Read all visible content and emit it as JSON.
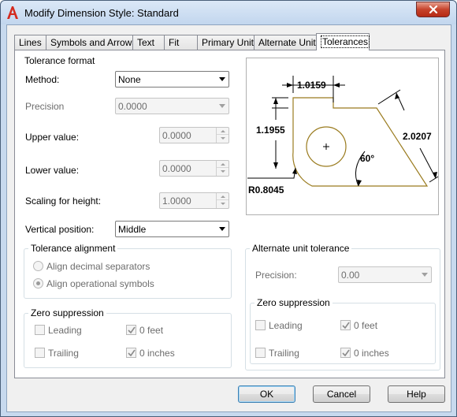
{
  "window": {
    "title": "Modify Dimension Style: Standard",
    "app_icon": "autocad-a-icon",
    "close_icon": "close-x-icon"
  },
  "tabs": [
    {
      "label": "Lines",
      "active": false
    },
    {
      "label": "Symbols and Arrows",
      "active": false
    },
    {
      "label": "Text",
      "active": false
    },
    {
      "label": "Fit",
      "active": false
    },
    {
      "label": "Primary Units",
      "active": false
    },
    {
      "label": "Alternate Units",
      "active": false
    },
    {
      "label": "Tolerances",
      "active": true
    }
  ],
  "tolerance_format": {
    "title": "Tolerance format",
    "method_label": "Method:",
    "method_value": "None",
    "precision_label": "Precision",
    "precision_value": "0.0000",
    "upper_label": "Upper value:",
    "upper_value": "0.0000",
    "lower_label": "Lower value:",
    "lower_value": "0.0000",
    "scaling_label": "Scaling for height:",
    "scaling_value": "1.0000",
    "vertical_label": "Vertical position:",
    "vertical_value": "Middle"
  },
  "tolerance_alignment": {
    "title": "Tolerance alignment",
    "option_decimal": "Align decimal separators",
    "option_operational": "Align operational symbols",
    "selected": "operational"
  },
  "zero_suppression_primary": {
    "title": "Zero suppression",
    "leading": {
      "label": "Leading",
      "checked": false
    },
    "trailing": {
      "label": "Trailing",
      "checked": false
    },
    "feet": {
      "label": "0 feet",
      "checked": true
    },
    "inches": {
      "label": "0 inches",
      "checked": true
    }
  },
  "alternate_unit_tolerance": {
    "title": "Alternate unit tolerance",
    "precision_label": "Precision:",
    "precision_value": "0.00"
  },
  "zero_suppression_alternate": {
    "title": "Zero suppression",
    "leading": {
      "label": "Leading",
      "checked": false
    },
    "trailing": {
      "label": "Trailing",
      "checked": false
    },
    "feet": {
      "label": "0 feet",
      "checked": true
    },
    "inches": {
      "label": "0 inches",
      "checked": true
    }
  },
  "preview": {
    "dim_top": "1.0159",
    "dim_left": "1.1955",
    "dim_right": "2.0207",
    "dim_angle": "60°",
    "dim_radius": "R0.8045",
    "shape_color": "#9a7b1e"
  },
  "buttons": {
    "ok": "OK",
    "cancel": "Cancel",
    "help": "Help"
  }
}
